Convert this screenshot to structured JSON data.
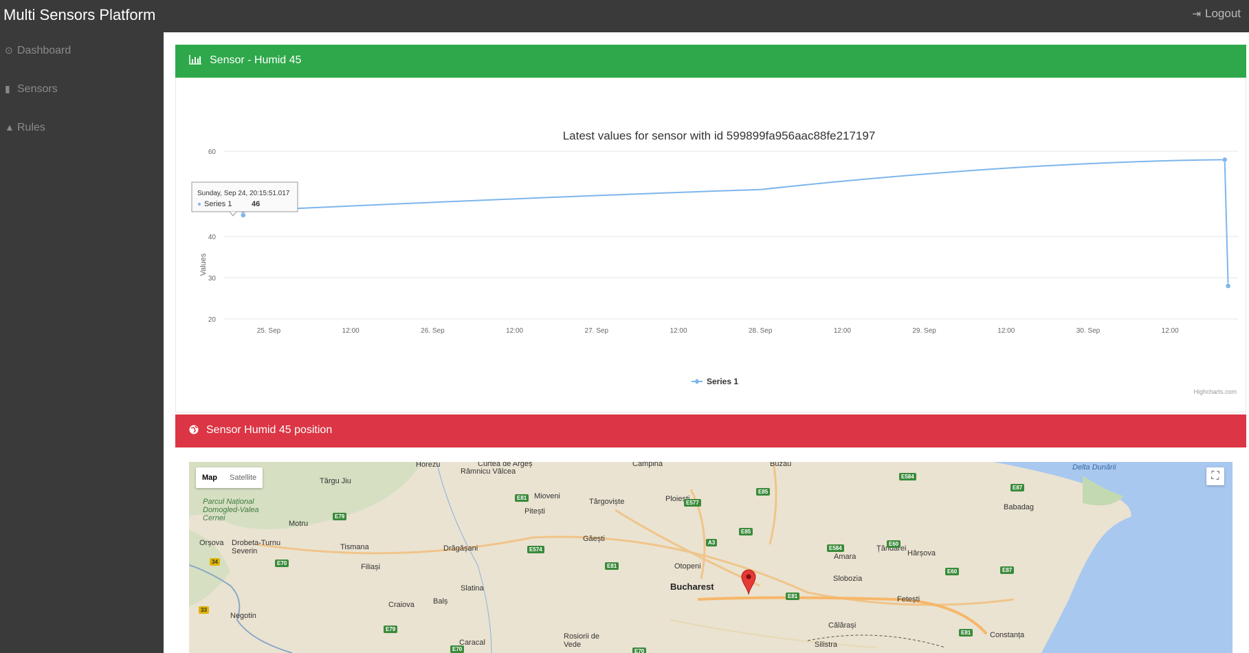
{
  "navbar": {
    "brand": "Multi Sensors Platform",
    "logout_label": "Logout"
  },
  "sidebar": {
    "items": [
      {
        "label": "Dashboard",
        "icon": "dashboard-icon"
      },
      {
        "label": "Sensors",
        "icon": "thermometer-icon"
      },
      {
        "label": "Rules",
        "icon": "warning-icon"
      }
    ]
  },
  "chart_panel": {
    "title": "Sensor - Humid 45",
    "icon": "bar-chart-icon"
  },
  "map_panel": {
    "title": "Sensor Humid 45 position",
    "icon": "globe-icon"
  },
  "chart_data": {
    "type": "line",
    "title": "Latest values for sensor with id 599899fa956aac88fe217197",
    "ylabel": "Values",
    "xlabel": "",
    "ylim": [
      20,
      60
    ],
    "yticks": [
      "60",
      "40",
      "30",
      "20"
    ],
    "xticks": [
      "25. Sep",
      "12:00",
      "26. Sep",
      "12:00",
      "27. Sep",
      "12:00",
      "28. Sep",
      "12:00",
      "29. Sep",
      "12:00",
      "30. Sep",
      "12:00"
    ],
    "series": [
      {
        "name": "Series 1",
        "color": "#7cb5ec",
        "points": [
          {
            "x": "2017-09-24T20:15",
            "y": 45
          },
          {
            "x": "2017-09-24T20:15",
            "y": 46
          },
          {
            "x": "2017-09-28T00:00",
            "y": 51
          },
          {
            "x": "2017-09-30T20:00",
            "y": 58
          },
          {
            "x": "2017-09-30T20:30",
            "y": 28
          }
        ]
      }
    ],
    "tooltip": {
      "date": "Sunday, Sep 24, 20:15:51.017",
      "series": "Series 1",
      "value": "46"
    },
    "legend": "bottom-center",
    "credits": "Highcharts.com",
    "grid": true
  },
  "map": {
    "type_options": [
      "Map",
      "Satellite"
    ],
    "selected": "Map",
    "labels": [
      "Horezu",
      "Râmnicu Vâlcea",
      "Curtea de Argeș",
      "Câmpina",
      "Buzău",
      "Delta Dunării",
      "Târgu Jiu",
      "Parcul Național Domogled-Valea Cernei",
      "Motru",
      "Drobeta-Turnu Severin",
      "Orșova",
      "Tismana",
      "Filiași",
      "Drăgășani",
      "Slatina",
      "Craiova",
      "Balș",
      "Pitești",
      "Mioveni",
      "Târgoviște",
      "Găești",
      "Ploiești",
      "Otopeni",
      "Bucharest",
      "Slobozia",
      "Țăndărei",
      "Hârșova",
      "Amara",
      "Fetești",
      "Călărași",
      "Silistra",
      "Constanța",
      "Babadag",
      "Rosiorii de Vede",
      "Caracal",
      "Negotin"
    ]
  }
}
